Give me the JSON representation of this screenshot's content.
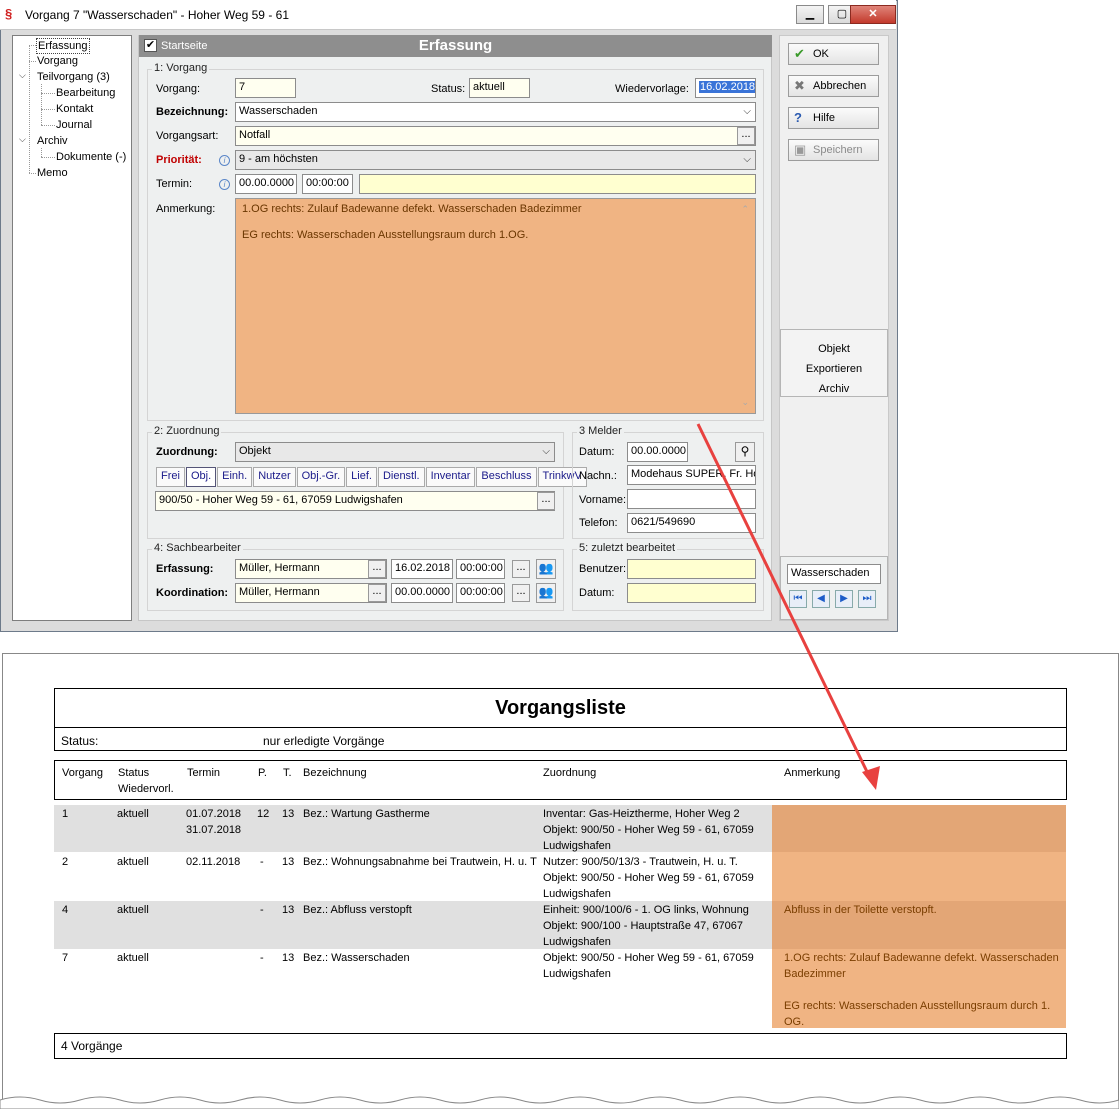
{
  "window": {
    "title": "Vorgang 7 \"Wasserschaden\" - Hoher Weg 59 - 61",
    "app_icon_text": "1"
  },
  "tree": {
    "items": [
      {
        "label": "Erfassung"
      },
      {
        "label": "Vorgang"
      },
      {
        "label": "Teilvorgang (3)"
      },
      {
        "label": "Bearbeitung"
      },
      {
        "label": "Kontakt"
      },
      {
        "label": "Journal"
      },
      {
        "label": "Archiv"
      },
      {
        "label": "Dokumente (-)"
      },
      {
        "label": "Memo"
      }
    ]
  },
  "header": {
    "startseite_label": "Startseite",
    "title": "Erfassung"
  },
  "group1": {
    "label": "1: Vorgang",
    "vorgang_label": "Vorgang:",
    "vorgang_value": "7",
    "status_label": "Status:",
    "status_value": "aktuell",
    "wiedervorlage_label": "Wiedervorlage:",
    "wiedervorlage_value": "16.02.2018",
    "bezeichnung_label": "Bezeichnung:",
    "bezeichnung_value": "Wasserschaden",
    "vorgangsart_label": "Vorgangsart:",
    "vorgangsart_value": "Notfall",
    "prioritaet_label": "Priorität:",
    "prioritaet_value": "9 - am höchsten",
    "termin_label": "Termin:",
    "termin_date": "00.00.0000",
    "termin_time": "00:00:00",
    "anmerkung_label": "Anmerkung:",
    "anmerkung_line1": "1.OG rechts: Zulauf Badewanne defekt. Wasserschaden Badezimmer",
    "anmerkung_line2": "EG rechts: Wasserschaden Ausstellungsraum durch 1.OG."
  },
  "group2": {
    "label": "2: Zuordnung",
    "zuordnung_label": "Zuordnung:",
    "zuordnung_value": "Objekt",
    "tabs": [
      "Frei",
      "Obj.",
      "Einh.",
      "Nutzer",
      "Obj.-Gr.",
      "Lief.",
      "Dienstl.",
      "Inventar",
      "Beschluss",
      "TrinkwV"
    ],
    "objekt_value": "900/50 - Hoher Weg 59 - 61, 67059 Ludwigshafen"
  },
  "group3": {
    "label": "3 Melder",
    "datum_label": "Datum:",
    "datum_value": "00.00.0000",
    "nachname_label": "Nachn.:",
    "nachname_value": "Modehaus SUPER, Fr. Ho",
    "vorname_label": "Vorname:",
    "vorname_value": "",
    "telefon_label": "Telefon:",
    "telefon_value": "0621/549690"
  },
  "group4": {
    "label": "4: Sachbearbeiter",
    "erfassung_label": "Erfassung:",
    "erfassung_name": "Müller, Hermann",
    "erfassung_date": "16.02.2018",
    "erfassung_time": "00:00:00",
    "koordination_label": "Koordination:",
    "koordination_name": "Müller, Hermann",
    "koordination_date": "00.00.0000",
    "koordination_time": "00:00:00"
  },
  "group5": {
    "label": "5: zuletzt bearbeitet",
    "benutzer_label": "Benutzer:",
    "benutzer_value": "",
    "datum_label": "Datum:",
    "datum_value": ""
  },
  "buttons": {
    "ok": "OK",
    "abbrechen": "Abbrechen",
    "hilfe": "Hilfe",
    "speichern": "Speichern",
    "objekt_line1": "Objekt",
    "objekt_line2": "Exportieren",
    "objekt_line3": "Archiv",
    "nav_search_value": "Wasserschaden"
  },
  "report": {
    "title": "Vorgangsliste",
    "status_label": "Status:",
    "status_value": "nur erledigte Vorgänge",
    "columns": {
      "vorgang": "Vorgang",
      "status": "Status",
      "wiedervorl": "Wiedervorl.",
      "termin": "Termin",
      "p": "P.",
      "t": "T.",
      "bezeichnung": "Bezeichnung",
      "zuordnung": "Zuordnung",
      "anmerkung": "Anmerkung"
    },
    "rows": [
      {
        "vorgang": "1",
        "status": "aktuell",
        "termin1": "01.07.2018",
        "termin2": "31.07.2018",
        "p": "12",
        "t": "13",
        "bezeichnung": "Bez.: Wartung Gastherme",
        "zuordnung1": "Inventar: Gas-Heiztherme, Hoher Weg 2",
        "zuordnung2": "Objekt: 900/50 - Hoher Weg 59 - 61, 67059",
        "zuordnung3": "Ludwigshafen",
        "anmerkung1": "",
        "anmerkung2": "",
        "anmerkung3": ""
      },
      {
        "vorgang": "2",
        "status": "aktuell",
        "termin1": "02.11.2018",
        "termin2": "",
        "p": "-",
        "t": "13",
        "bezeichnung": "Bez.: Wohnungsabnahme bei Trautwein, H. u. T",
        "zuordnung1": "Nutzer: 900/50/13/3 - Trautwein, H. u. T.",
        "zuordnung2": "Objekt: 900/50 - Hoher Weg 59 - 61, 67059",
        "zuordnung3": "Ludwigshafen",
        "anmerkung1": "",
        "anmerkung2": "",
        "anmerkung3": ""
      },
      {
        "vorgang": "4",
        "status": "aktuell",
        "termin1": "",
        "termin2": "",
        "p": "-",
        "t": "13",
        "bezeichnung": "Bez.: Abfluss verstopft",
        "zuordnung1": "Einheit: 900/100/6 - 1. OG links, Wohnung",
        "zuordnung2": "Objekt: 900/100 - Hauptstraße 47, 67067",
        "zuordnung3": "Ludwigshafen",
        "anmerkung1": "Abfluss in der Toilette verstopft.",
        "anmerkung2": "",
        "anmerkung3": ""
      },
      {
        "vorgang": "7",
        "status": "aktuell",
        "termin1": "",
        "termin2": "",
        "p": "-",
        "t": "13",
        "bezeichnung": "Bez.: Wasserschaden",
        "zuordnung1": "Objekt: 900/50 - Hoher Weg 59 - 61, 67059",
        "zuordnung2": "Ludwigshafen",
        "zuordnung3": "",
        "anmerkung1": "1.OG rechts: Zulauf Badewanne defekt. Wasserschaden",
        "anmerkung2": "Badezimmer",
        "anmerkung3": "EG rechts: Wasserschaden Ausstellungsraum durch 1.",
        "anmerkung4": "OG."
      }
    ],
    "footer": "4 Vorgänge"
  },
  "colors": {
    "memo_orange": "#f0b483",
    "arrow_red": "#e8413f"
  }
}
